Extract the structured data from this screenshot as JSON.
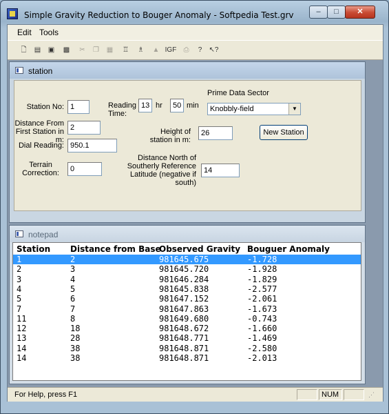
{
  "window": {
    "title": "Simple Gravity Reduction to Bouger Anomaly - Softpedia Test.grv",
    "min_icon": "minimize-icon",
    "max_icon": "maximize-icon",
    "close_icon": "close-icon"
  },
  "menu": {
    "items": [
      "Edit",
      "Tools"
    ]
  },
  "toolbar": {
    "buttons": [
      "new-file-icon",
      "open-folder-icon",
      "save-icon",
      "save-all-icon",
      "cut-icon",
      "copy-icon",
      "paste-icon",
      "gravimeter-icon",
      "station-icon",
      "terrain-icon",
      "igf-icon",
      "print-icon",
      "about-icon",
      "context-help-icon"
    ],
    "igf_label": "IGF"
  },
  "station": {
    "title": "station",
    "station_no_label": "Station No:",
    "station_no": "1",
    "distance_label_1": "Distance From",
    "distance_label_2": "First Station in m:",
    "distance": "2",
    "dial_label": "Dial Reading:",
    "dial": "950.1",
    "terrain_label_1": "Terrain",
    "terrain_label_2": "Correction:",
    "terrain": "0",
    "reading_label_1": "Reading",
    "reading_label_2": "Time:",
    "hours": "13",
    "hr_label": "hr",
    "minutes": "50",
    "min_label": "min",
    "height_label_1": "Height of",
    "height_label_2": "station in m:",
    "height": "26",
    "north_label_1": "Distance North of",
    "north_label_2": "Southerly Reference",
    "north_label_3": "Latitude (negative  if",
    "north_label_4": "south)",
    "north": "14",
    "sector_label": "Prime Data Sector",
    "sector_value": "Knobbly-field",
    "new_station_label": "New Station"
  },
  "notepad": {
    "title": "notepad",
    "columns": [
      "Station",
      "Distance from Base",
      "Observed Gravity",
      "Bouguer Anomaly"
    ],
    "rows": [
      [
        "1",
        "2",
        "981645.675",
        "-1.728"
      ],
      [
        "2",
        "3",
        "981645.720",
        "-1.928"
      ],
      [
        "3",
        "4",
        "981646.284",
        "-1.829"
      ],
      [
        "4",
        "5",
        "981645.838",
        "-2.577"
      ],
      [
        "5",
        "6",
        "981647.152",
        "-2.061"
      ],
      [
        "7",
        "7",
        "981647.863",
        "-1.673"
      ],
      [
        "11",
        "8",
        "981649.680",
        "-0.743"
      ],
      [
        "12",
        "18",
        "981648.672",
        "-1.660"
      ],
      [
        "13",
        "28",
        "981648.771",
        "-1.469"
      ],
      [
        "14",
        "38",
        "981648.871",
        "-2.580"
      ],
      [
        "14",
        "38",
        "981648.871",
        "-2.013"
      ]
    ]
  },
  "status": {
    "help": "For Help, press F1",
    "num": "NUM"
  }
}
